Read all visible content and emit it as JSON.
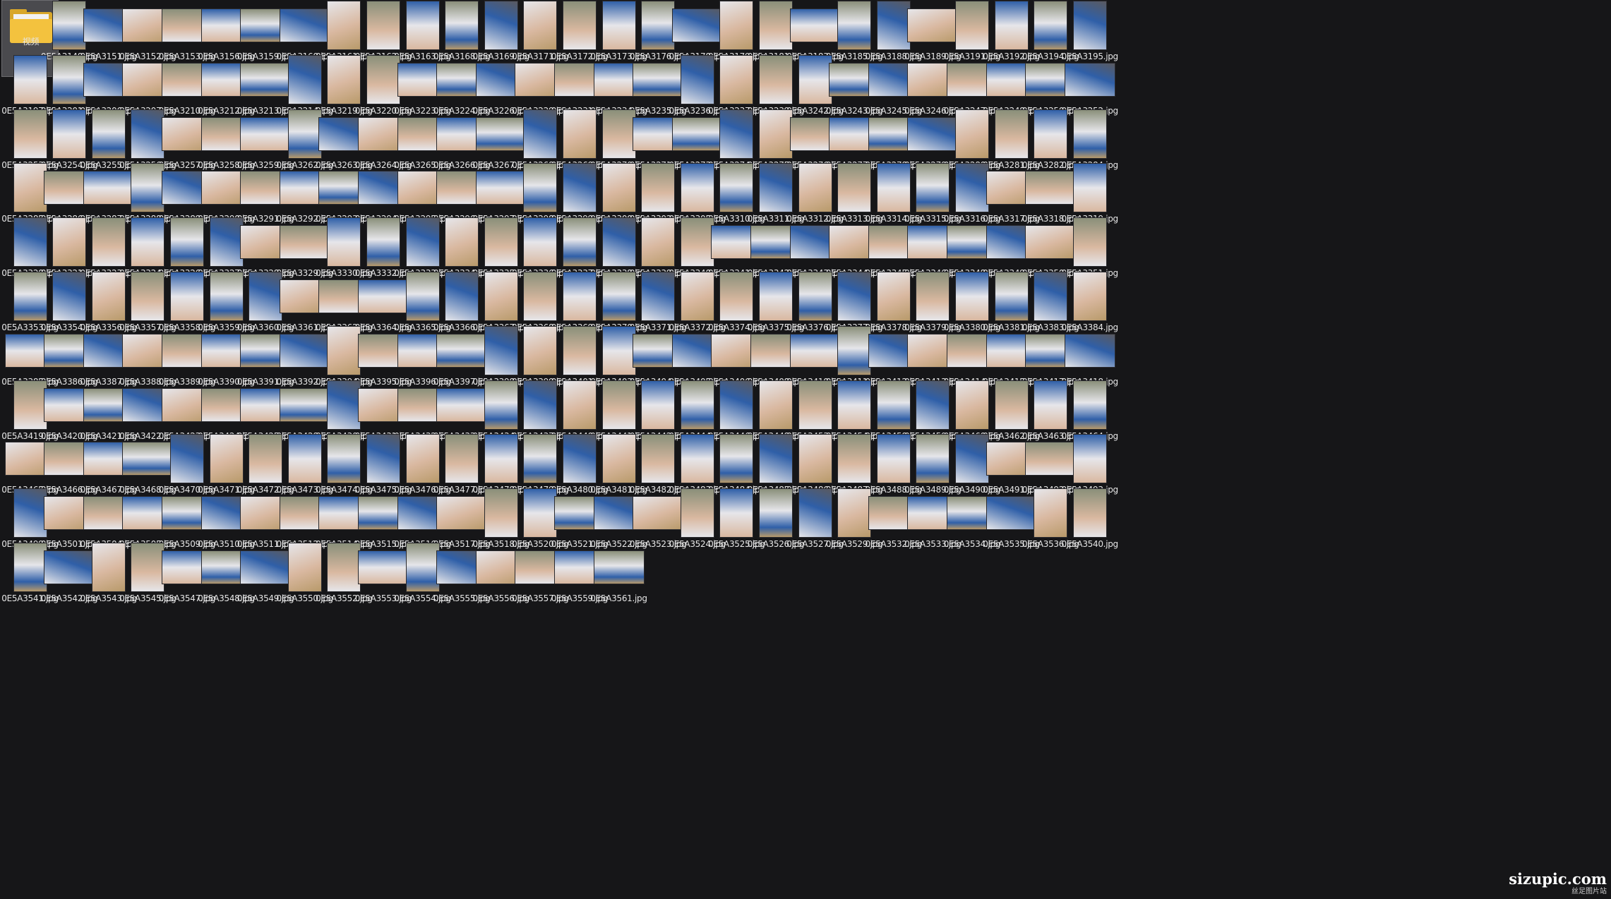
{
  "folder": {
    "name": "视频",
    "icon": "folder-icon"
  },
  "files_ext": "jpg",
  "files": [
    [
      "0E5A3148.jpg",
      "0E5A3151.jpg",
      "0E5A3152.jpg",
      "0E5A3153.jpg",
      "0E5A3156.jpg",
      "0E5A3159.jpg",
      "0E5A3160.jpg",
      "0E5A3161.jpg",
      "0E5A3162.jpg",
      "0E5A3163.jpg",
      "0E5A3168.jpg",
      "0E5A3169.jpg",
      "0E5A3171.jpg",
      "0E5A3172.jpg",
      "0E5A3173.jpg",
      "0E5A3176.jpg",
      "0E5A3178.jpg",
      "0E5A3179.jpg",
      "0E5A3181.jpg",
      "0E5A3183.jpg",
      "0E5A3185.jpg",
      "0E5A3188.jpg",
      "0E5A3189.jpg",
      "0E5A3191.jpg",
      "0E5A3192.jpg",
      "0E5A3194.jpg",
      "0E5A3195.jpg"
    ],
    [
      "0E5A3197.jpg",
      "0E5A3201.jpg",
      "0E5A3206.jpg",
      "0E5A3207.jpg",
      "0E5A3210.jpg",
      "0E5A3212.jpg",
      "0E5A3213.jpg",
      "0E5A3214.jpg",
      "0E5A3219.jpg",
      "0E5A3220.jpg",
      "0E5A3223.jpg",
      "0E5A3224.jpg",
      "0E5A3226.jpg",
      "0E5A3229.jpg",
      "0E5A3231.jpg",
      "0E5A3234.jpg",
      "0E5A3235.jpg",
      "0E5A3236.jpg",
      "0E5A3237.jpg",
      "0E5A3239.jpg",
      "0E5A3242.jpg",
      "0E5A3243.jpg",
      "0E5A3245.jpg",
      "0E5A3246.jpg",
      "0E5A3247.jpg",
      "0E5A3248.jpg",
      "0E5A3250.jpg",
      "0E5A3252.jpg"
    ],
    [
      "0E5A3253.jpg",
      "0E5A3254.jpg",
      "0E5A3255.jpg",
      "0E5A3256.jpg",
      "0E5A3257.jpg",
      "0E5A3258.jpg",
      "0E5A3259.jpg",
      "0E5A3262.jpg",
      "0E5A3263.jpg",
      "0E5A3264.jpg",
      "0E5A3265.jpg",
      "0E5A3266.jpg",
      "0E5A3267.jpg",
      "0E5A3268.jpg",
      "0E5A3269.jpg",
      "0E5A3270.jpg",
      "0E5A3271.jpg",
      "0E5A3273.jpg",
      "0E5A3274.jpg",
      "0E5A3275.jpg",
      "0E5A3276.jpg",
      "0E5A3277.jpg",
      "0E5A3278.jpg",
      "0E5A3279.jpg",
      "0E5A3280.jpg",
      "0E5A3281.jpg",
      "0E5A3282.jpg",
      "0E5A3284.jpg"
    ],
    [
      "0E5A3285.jpg",
      "0E5A3286.jpg",
      "0E5A3287.jpg",
      "0E5A3288.jpg",
      "0E5A3289.jpg",
      "0E5A3290.jpg",
      "0E5A3291.jpg",
      "0E5A3292.jpg",
      "0E5A3293.jpg",
      "0E5A3294.jpg",
      "0E5A3295.jpg",
      "0E5A3296.jpg",
      "0E5A3297.jpg",
      "0E5A3298.jpg",
      "0E5A3299.jpg",
      "0E5A3300.jpg",
      "0E5A3302.jpg",
      "0E5A3305.jpg",
      "0E5A3310.jpg",
      "0E5A3311.jpg",
      "0E5A3312.jpg",
      "0E5A3313.jpg",
      "0E5A3314.jpg",
      "0E5A3315.jpg",
      "0E5A3316.jpg",
      "0E5A3317.jpg",
      "0E5A3318.jpg",
      "0E5A3319.jpg"
    ],
    [
      "0E5A3320.jpg",
      "0E5A3321.jpg",
      "0E5A3323.jpg",
      "0E5A3324.jpg",
      "0E5A3326.jpg",
      "0E5A3327.jpg",
      "0E5A3328.jpg",
      "0E5A3329.jpg",
      "0E5A3330.jpg",
      "0E5A3332.jpg",
      "0E5A3333.jpg",
      "0E5A3334.jpg",
      "0E5A3335.jpg",
      "0E5A3336.jpg",
      "0E5A3337.jpg",
      "0E5A3338.jpg",
      "0E5A3339.jpg",
      "0E5A3340.jpg",
      "0E5A3341.jpg",
      "0E5A3342.jpg",
      "0E5A3343.jpg",
      "0E5A3344.jpg",
      "0E5A3345.jpg",
      "0E5A3346.jpg",
      "0E5A3348.jpg",
      "0E5A3349.jpg",
      "0E5A3350.jpg",
      "0E5A3351.jpg"
    ],
    [
      "0E5A3353.jpg",
      "0E5A3354.jpg",
      "0E5A3356.jpg",
      "0E5A3357.jpg",
      "0E5A3358.jpg",
      "0E5A3359.jpg",
      "0E5A3360.jpg",
      "0E5A3361.jpg",
      "0E5A3362.jpg",
      "0E5A3364.jpg",
      "0E5A3365.jpg",
      "0E5A3366.jpg",
      "0E5A3367.jpg",
      "0E5A3368.jpg",
      "0E5A3369.jpg",
      "0E5A3370.jpg",
      "0E5A3371.jpg",
      "0E5A3372.jpg",
      "0E5A3374.jpg",
      "0E5A3375.jpg",
      "0E5A3376.jpg",
      "0E5A3377.jpg",
      "0E5A3378.jpg",
      "0E5A3379.jpg",
      "0E5A3380.jpg",
      "0E5A3381.jpg",
      "0E5A3383.jpg",
      "0E5A3384.jpg"
    ],
    [
      "0E5A3385.jpg",
      "0E5A3386.jpg",
      "0E5A3387.jpg",
      "0E5A3388.jpg",
      "0E5A3389.jpg",
      "0E5A3390.jpg",
      "0E5A3391.jpg",
      "0E5A3392.jpg",
      "0E5A3394.jpg",
      "0E5A3395.jpg",
      "0E5A3396.jpg",
      "0E5A3397.jpg",
      "0E5A3398.jpg",
      "0E5A3399.jpg",
      "0E5A3401.jpg",
      "0E5A3403.jpg",
      "0E5A3404.jpg",
      "0E5A3405.jpg",
      "0E5A3406.jpg",
      "0E5A3408.jpg",
      "0E5A3410.jpg",
      "0E5A3411.jpg",
      "0E5A3412.jpg",
      "0E5A3413.jpg",
      "0E5A3414.jpg",
      "0E5A3415.jpg",
      "0E5A3417.jpg",
      "0E5A3418.jpg"
    ],
    [
      "0E5A3419.jpg",
      "0E5A3420.jpg",
      "0E5A3421.jpg",
      "0E5A3422.jpg",
      "0E5A3423.jpg",
      "0E5A3424.jpg",
      "0E5A3425.jpg",
      "0E5A3428.jpg",
      "0E5A3430.jpg",
      "0E5A3431.jpg",
      "0E5A3432.jpg",
      "0E5A3433.jpg",
      "0E5A3434.jpg",
      "0E5A3437.jpg",
      "0E5A3440.jpg",
      "0E5A3441.jpg",
      "0E5A3442.jpg",
      "0E5A3444.jpg",
      "0E5A3446.jpg",
      "0E5A3448.jpg",
      "0E5A3453.jpg",
      "0E5A3454.jpg",
      "0E5A3458.jpg",
      "0E5A3459.jpg",
      "0E5A3460.jpg",
      "0E5A3462.jpg",
      "0E5A3463.jpg",
      "0E5A3464.jpg"
    ],
    [
      "0E5A3465.jpg",
      "0E5A3466.jpg",
      "0E5A3467.jpg",
      "0E5A3468.jpg",
      "0E5A3470.jpg",
      "0E5A3471.jpg",
      "0E5A3472.jpg",
      "0E5A3473.jpg",
      "0E5A3474.jpg",
      "0E5A3475.jpg",
      "0E5A3476.jpg",
      "0E5A3477.jpg",
      "0E5A3478.jpg",
      "0E5A3479.jpg",
      "0E5A3480.jpg",
      "0E5A3481.jpg",
      "0E5A3482.jpg",
      "0E5A3483.jpg",
      "0E5A3484.jpg",
      "0E5A3485.jpg",
      "0E5A3486.jpg",
      "0E5A3487.jpg",
      "0E5A3488.jpg",
      "0E5A3489.jpg",
      "0E5A3490.jpg",
      "0E5A3491.jpg",
      "0E5A3492.jpg",
      "0E5A3493.jpg"
    ],
    [
      "0E5A3499.jpg",
      "0E5A3501.jpg",
      "0E5A3504.jpg",
      "0E5A3505.jpg",
      "0E5A3509.jpg",
      "0E5A3510.jpg",
      "0E5A3511.jpg",
      "0E5A3512.jpg",
      "0E5A3514.jpg",
      "0E5A3515.jpg",
      "0E5A3516.jpg",
      "0E5A3517.jpg",
      "0E5A3518.jpg",
      "0E5A3520.jpg",
      "0E5A3521.jpg",
      "0E5A3522.jpg",
      "0E5A3523.jpg",
      "0E5A3524.jpg",
      "0E5A3525.jpg",
      "0E5A3526.jpg",
      "0E5A3527.jpg",
      "0E5A3529.jpg",
      "0E5A3532.jpg",
      "0E5A3533.jpg",
      "0E5A3534.jpg",
      "0E5A3535.jpg",
      "0E5A3536.jpg",
      "0E5A3540.jpg"
    ],
    [
      "0E5A3541.jpg",
      "0E5A3542.jpg",
      "0E5A3543.jpg",
      "0E5A3545.jpg",
      "0E5A3547.jpg",
      "0E5A3548.jpg",
      "0E5A3549.jpg",
      "0E5A3550.jpg",
      "0E5A3552.jpg",
      "0E5A3553.jpg",
      "0E5A3554.jpg",
      "0E5A3555.jpg",
      "0E5A3556.jpg",
      "0E5A3557.jpg",
      "0E5A3559.jpg",
      "0E5A3561.jpg"
    ]
  ],
  "orientation": [
    "pllllllppppppppplpplpplpppp",
    "pplllllppplllllllpppplllllll",
    "pppplllplllllpppllppllllpppp",
    "pllplllllllllppppppppppppllp",
    "ppppppllpppppppppplllllllllpp",
    "ppppppplllpppppppppppppppppp",
    "llllllllplllpppplllllpllllll",
    "plllllllplllpppppppppppppppp",
    "llllpppppppppppppppppppppllp",
    "plllllllllllpplllpppppllllp",
    "plpplllpplplllllp"
  ],
  "thumb_colors": {
    "classroom": "#8a8f7a",
    "uniform": "#2f5fa8",
    "skin": "#d9b8a0",
    "white": "#e6e6ea",
    "floor": "#b89a6a",
    "shadow": "#5a5a60"
  },
  "watermark": {
    "main": "sizupic.com",
    "sub": "丝足图片站"
  }
}
